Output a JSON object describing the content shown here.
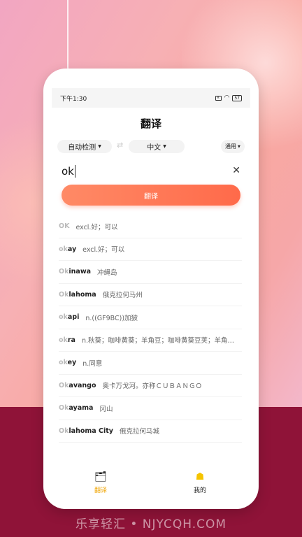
{
  "status": {
    "time": "下午1:30",
    "battery": "57"
  },
  "header": {
    "title": "翻译"
  },
  "languages": {
    "source": "自动检测",
    "target": "中文",
    "mode": "通用"
  },
  "input": {
    "query": "ok"
  },
  "translate_button": "翻译",
  "suggestions": [
    {
      "prefix": "OK",
      "suffix": "",
      "definition": "excl.好；可以"
    },
    {
      "prefix": "ok",
      "suffix": "ay",
      "definition": "excl.好；可以"
    },
    {
      "prefix": "Ok",
      "suffix": "inawa",
      "definition": "冲绳岛"
    },
    {
      "prefix": "Ok",
      "suffix": "lahoma",
      "definition": "俄克拉何马州"
    },
    {
      "prefix": "ok",
      "suffix": "api",
      "definition": "n.((GF9BC))加狓"
    },
    {
      "prefix": "ok",
      "suffix": "ra",
      "definition": "n.秋葵；咖啡黄葵；羊角豆；咖啡黄葵豆荚；羊角…"
    },
    {
      "prefix": "ok",
      "suffix": "ey",
      "definition": "n.同意"
    },
    {
      "prefix": "Ok",
      "suffix": "avango",
      "definition": "奥卡万戈河。亦称ＣＵＢＡＮＧＯ"
    },
    {
      "prefix": "Ok",
      "suffix": "ayama",
      "definition": "冈山"
    },
    {
      "prefix": "Ok",
      "suffix": "lahoma City",
      "definition": "俄克拉何马城"
    }
  ],
  "tabs": [
    {
      "label": "翻译",
      "icon": "translate-icon"
    },
    {
      "label": "我的",
      "icon": "profile-icon"
    }
  ],
  "footer": {
    "watermark": "乐享轻汇 • NJYCQH.COM"
  },
  "colors": {
    "accent": "#ff7a57",
    "fab": "#f7e02a",
    "active_tab": "#f0a400",
    "bottom_bg": "#8f1338"
  }
}
